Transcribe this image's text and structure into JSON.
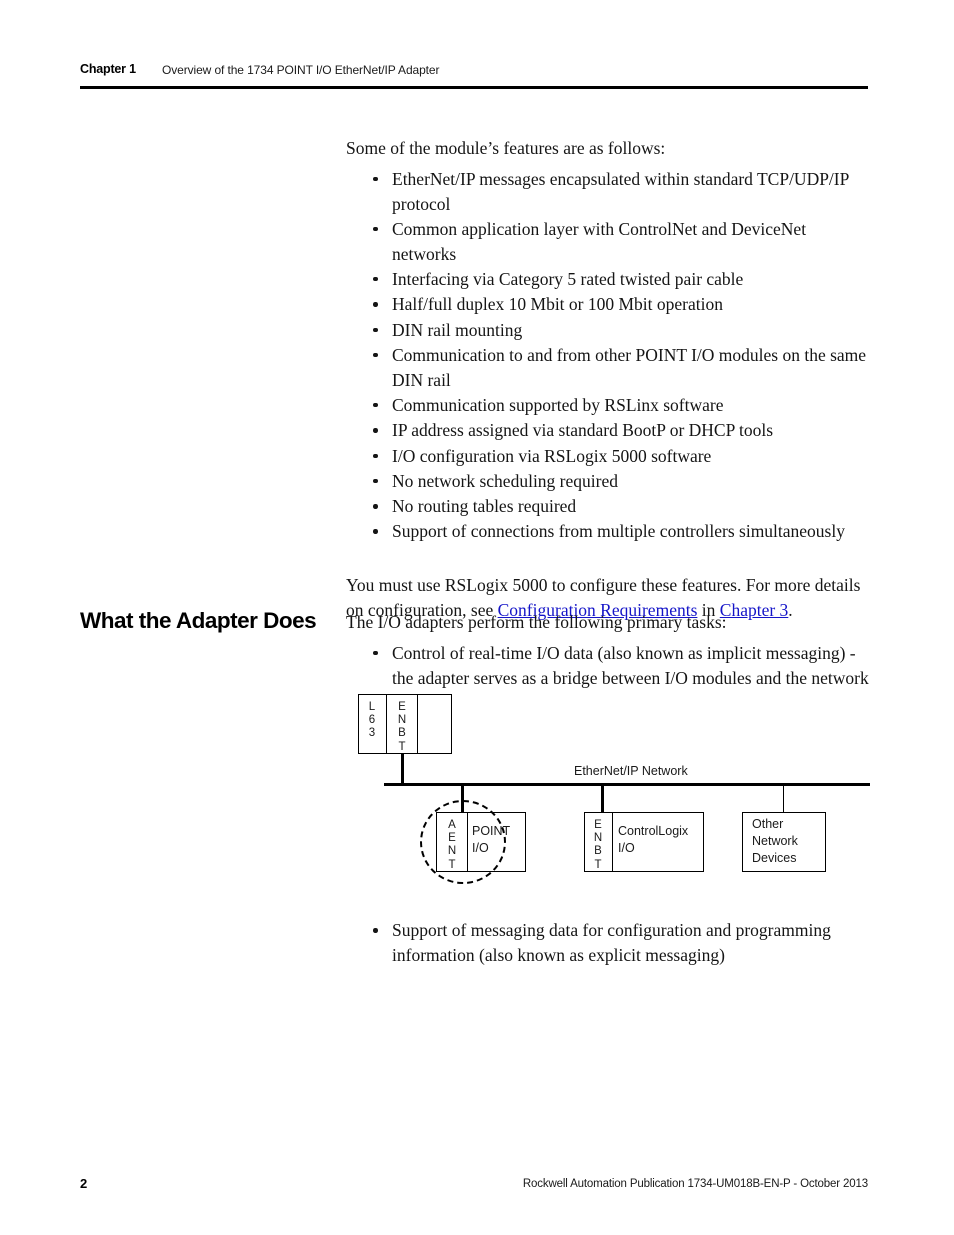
{
  "header": {
    "chapter_label": "Chapter 1",
    "chapter_title": "Overview of the 1734 POINT I/O EtherNet/IP Adapter"
  },
  "intro": {
    "lead": "Some of the module’s features are as follows:",
    "features": [
      "EtherNet/IP messages encapsulated within standard TCP/UDP/IP protocol",
      "Common application layer with ControlNet and DeviceNet networks",
      "Interfacing via Category 5 rated twisted pair cable",
      "Half/full duplex 10 Mbit or 100 Mbit operation",
      "DIN rail mounting",
      "Communication to and from other POINT I/O modules on the same DIN rail",
      "Communication supported by RSLinx software",
      "IP address assigned via standard BootP or DHCP tools",
      "I/O configuration via RSLogix 5000 software",
      "No network scheduling required",
      "No routing tables required",
      "Support of connections from multiple controllers simultaneously"
    ],
    "closing_before_link1": "You must use RSLogix 5000 to configure these features. For more details on configuration, see ",
    "link1": "Configuration Requirements",
    "between_links": " in ",
    "link2": "Chapter 3",
    "closing_after_link2": "."
  },
  "section": {
    "heading": "What the Adapter Does",
    "lead": "The I/O adapters perform the following primary tasks:",
    "task_1": "Control of real-time I/O data (also known as implicit messaging) - the adapter serves as a bridge between I/O modules and the network",
    "task_2": "Support of messaging data for configuration and programming information (also known as explicit messaging)"
  },
  "diagram": {
    "network_label": "EtherNet/IP Network",
    "chassis_top": {
      "slot1": "L\n6\n3",
      "slot2": "E\nN\nB\nT",
      "slot3": ""
    },
    "node_aent": {
      "module": "A\nE\nN\nT",
      "label_line1": "POINT",
      "label_line2": "I/O"
    },
    "node_controllogix": {
      "module": "E\nN\nB\nT",
      "label_line1": "ControlLogix",
      "label_line2": "I/O"
    },
    "node_other": {
      "line1": "Other",
      "line2": "Network",
      "line3": "Devices"
    }
  },
  "footer": {
    "page_number": "2",
    "publication": "Rockwell Automation Publication 1734-UM018B-EN-P - October 2013"
  },
  "colors": {
    "link": "#1414c8",
    "text": "#151515",
    "rule": "#000000"
  }
}
